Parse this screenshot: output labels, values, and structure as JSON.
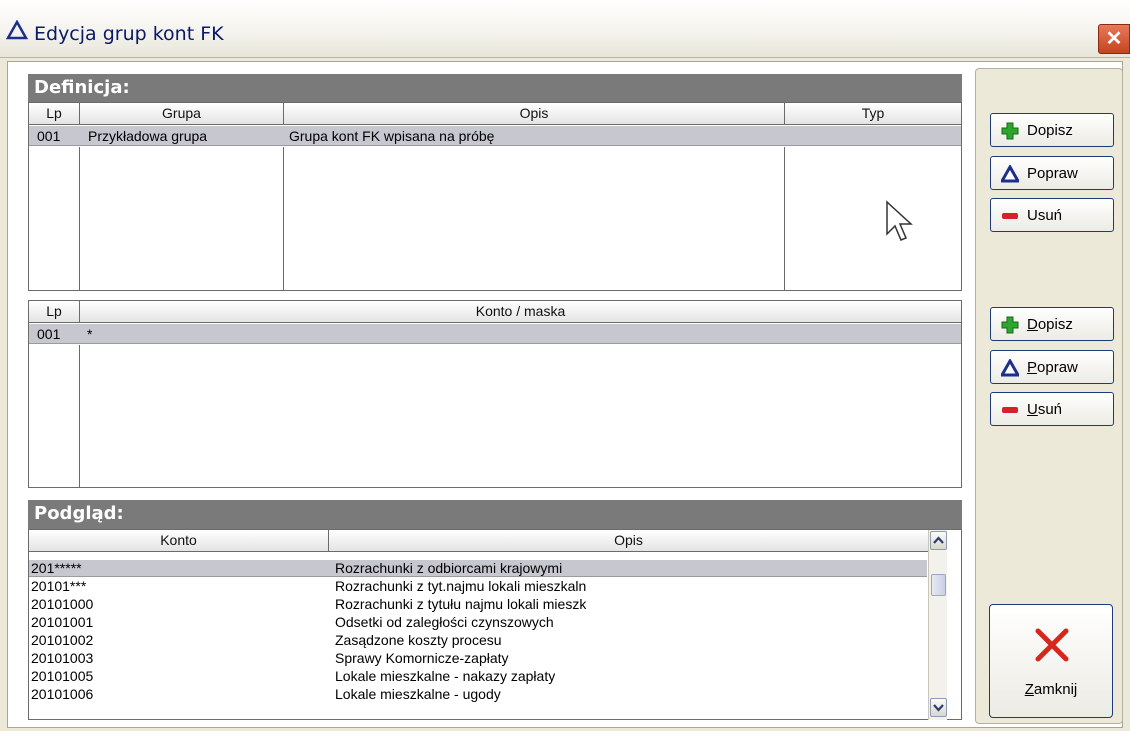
{
  "window": {
    "title": "Edycja grup kont FK",
    "close_glyph": "✕"
  },
  "definicja": {
    "title": "Definicja:",
    "columns": [
      "Lp",
      "Grupa",
      "Opis",
      "Typ"
    ],
    "rows": [
      {
        "lp": "001",
        "grupa": "Przykładowa grupa",
        "opis": "Grupa kont FK wpisana na próbę",
        "typ": ""
      }
    ]
  },
  "konta": {
    "columns": [
      "Lp",
      "Konto / maska"
    ],
    "rows": [
      {
        "lp": "001",
        "konto": "*"
      }
    ]
  },
  "podglad": {
    "title": "Podgląd:",
    "columns": [
      "Konto",
      "Opis"
    ],
    "rows": [
      {
        "konto": "201*****",
        "opis": "Rozrachunki z odbiorcami krajowymi"
      },
      {
        "konto": "20101***",
        "opis": "Rozrachunki z tyt.najmu lokali mieszkaln"
      },
      {
        "konto": "20101000",
        "opis": "Rozrachunki z tytułu najmu lokali mieszk"
      },
      {
        "konto": "20101001",
        "opis": "Odsetki od zaległości czynszowych"
      },
      {
        "konto": "20101002",
        "opis": "Zasądzone koszty procesu"
      },
      {
        "konto": "20101003",
        "opis": "Sprawy Komornicze-zapłaty"
      },
      {
        "konto": "20101005",
        "opis": "Lokale mieszkalne - nakazy zapłaty"
      },
      {
        "konto": "20101006",
        "opis": "Lokale mieszkalne - ugody"
      }
    ]
  },
  "buttons": {
    "group1": {
      "add": "Dopisz",
      "edit": "Popraw",
      "delete": "Usuń"
    },
    "group2": {
      "add_first": "D",
      "add_rest": "opisz",
      "edit_first": "P",
      "edit_rest": "opraw",
      "delete_first": "U",
      "delete_rest": "suń"
    },
    "close_first": "Z",
    "close_rest": "amknij"
  },
  "colors": {
    "section_header": "#7a7a7a",
    "selected_row": "#c7c7cf",
    "add_green": "#2ea52e",
    "edit_navy": "#1c2f8a",
    "delete_red": "#d8202a",
    "close_red": "#d7261b"
  }
}
